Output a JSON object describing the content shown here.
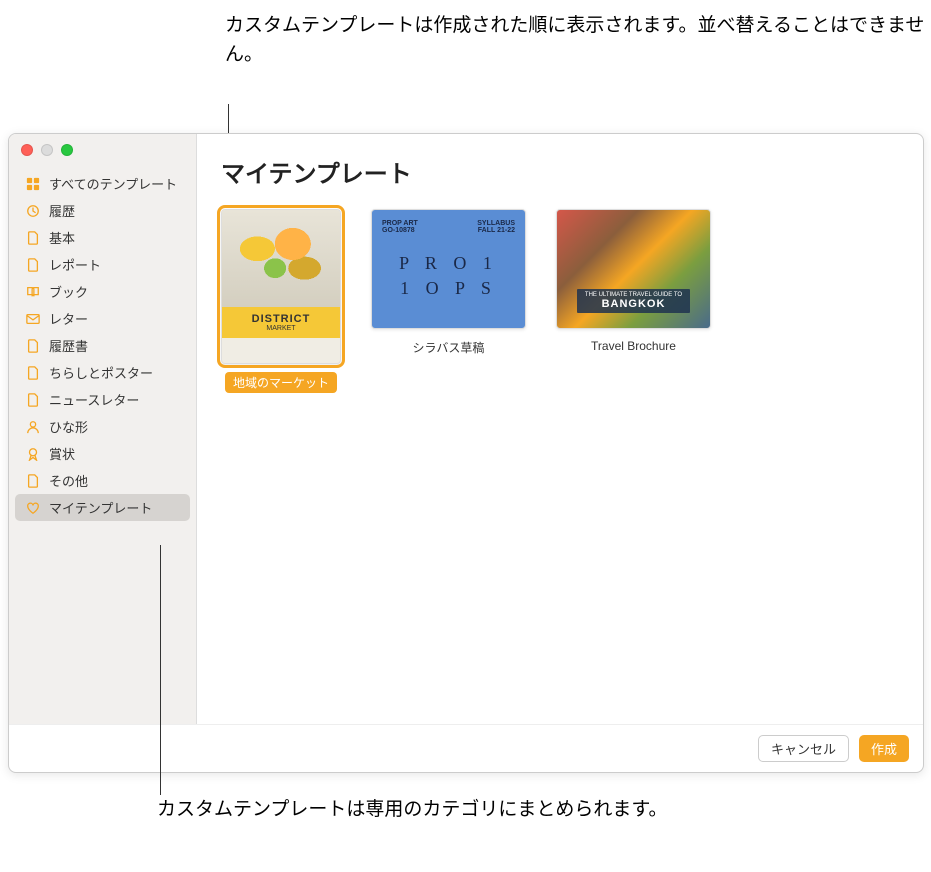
{
  "callouts": {
    "top": "カスタムテンプレートは作成された順に表示されます。並べ替えることはできません。",
    "bottom": "カスタムテンプレートは専用のカテゴリにまとめられます。"
  },
  "sidebar": {
    "items": [
      {
        "label": "すべてのテンプレート",
        "icon": "grid"
      },
      {
        "label": "履歴",
        "icon": "clock"
      },
      {
        "label": "基本",
        "icon": "doc"
      },
      {
        "label": "レポート",
        "icon": "doc"
      },
      {
        "label": "ブック",
        "icon": "book"
      },
      {
        "label": "レター",
        "icon": "envelope"
      },
      {
        "label": "履歴書",
        "icon": "doc"
      },
      {
        "label": "ちらしとポスター",
        "icon": "doc"
      },
      {
        "label": "ニュースレター",
        "icon": "doc"
      },
      {
        "label": "ひな形",
        "icon": "person"
      },
      {
        "label": "賞状",
        "icon": "ribbon"
      },
      {
        "label": "その他",
        "icon": "doc"
      },
      {
        "label": "マイテンプレート",
        "icon": "heart",
        "selected": true
      }
    ]
  },
  "main": {
    "title": "マイテンプレート",
    "templates": [
      {
        "label": "地域のマーケット",
        "selected": true,
        "thumb_title": "DISTRICT",
        "thumb_sub": "MARKET"
      },
      {
        "label": "シラバス草稿",
        "thumb_left": "PROP ART\nGO-10878",
        "thumb_right": "SYLLABUS\nFALL 21-22",
        "thumb_body": "P R O 1\n1 O P S"
      },
      {
        "label": "Travel Brochure",
        "thumb_tag_small": "THE ULTIMATE TRAVEL GUIDE TO",
        "thumb_tag_big": "BANGKOK"
      }
    ]
  },
  "footer": {
    "cancel": "キャンセル",
    "create": "作成"
  }
}
